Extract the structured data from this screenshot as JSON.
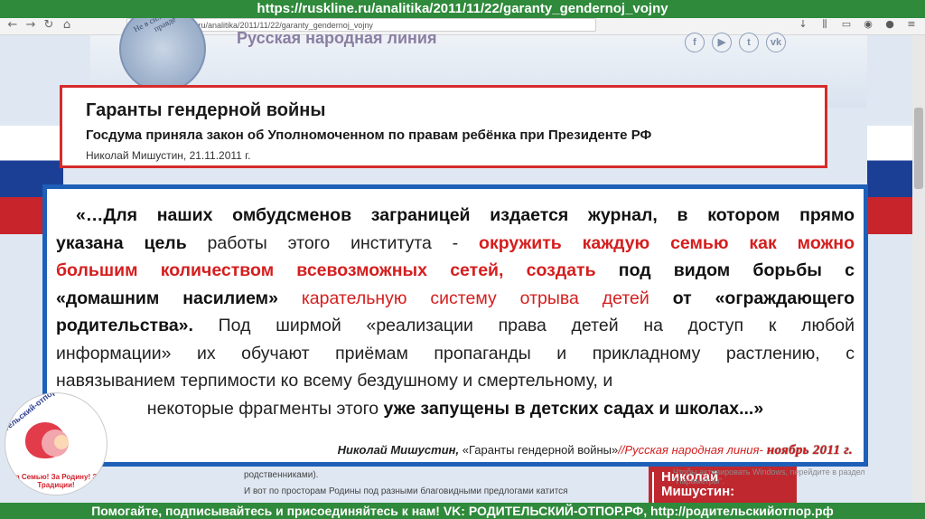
{
  "top_url": "https://ruskline.ru/analitika/2011/11/22/garanty_gendernoj_vojny",
  "browser": {
    "address": "https://ruskline.ru/analitika/2011/11/22/garanty_gendernoj_vojny",
    "back_icon": "arrow-left-icon",
    "forward_icon": "arrow-right-icon",
    "reload_icon": "reload-icon",
    "home_icon": "home-icon"
  },
  "site": {
    "title": "Русская народная линия",
    "seal_text": "Не в силе Бог, а в правде",
    "social": [
      "f",
      "▶",
      "t",
      "vk"
    ]
  },
  "header": {
    "title": "Гаранты гендерной войны",
    "subtitle": "Госдума приняла закон об Уполномоченном по правам ребёнка при Президенте РФ",
    "author": "Николай Мишустин, 21.11.2011 г."
  },
  "quote": {
    "l1a": "«…Для наших омбудсменов заграницей издается журнал, в котором прямо",
    "l2a": "указана ",
    "l2b": "цель",
    "l2c": " работы этого института - ",
    "l2d": "окружить каждую семью как можно",
    "l3a": "большим количеством всевозможных сетей, создать",
    "l3b": " под видом борьбы с",
    "l4a": "«домашним насилием»",
    "l4b": " карательную систему отрыва детей",
    "l4c": " от «ограждающего",
    "l5a": "родительства».",
    "l5b": " Под ширмой «реализации права детей на доступ к любой",
    "l6": "информации» их обучают приёмам пропаганды и прикладному растлению, с",
    "l7": "навязыванием терпимости ко всему бездушному и смертельному, и",
    "l8a": "некоторые фрагменты этого ",
    "l8b": "уже запущены в детских садах и школах...»"
  },
  "signature": {
    "author": "Николай Мишустин,",
    "work": " «Гаранты гендерной войны»",
    "sep": "//",
    "source": "Русская народная линия-",
    "date": " ноябрь 2011 г."
  },
  "lower": {
    "line1": "родственниками).",
    "line2": "И вот по просторам Родины под разными благовидными предлогами катится"
  },
  "side_card": {
    "line1": "Николай",
    "line2": "Мишустин:"
  },
  "watermark": "Чтобы активировать Windows, перейдите в раздел \"Параметры\".",
  "logo": {
    "top": "родительский-отпор.рф",
    "bottom": "За Семью! За Родину! За Традиции!"
  },
  "bottom_bar": "Помогайте, подписывайтесь и присоединяйтесь к нам! VK: РОДИТЕЛЬСКИЙ-ОТПОР.РФ, http://родительскийотпор.рф"
}
